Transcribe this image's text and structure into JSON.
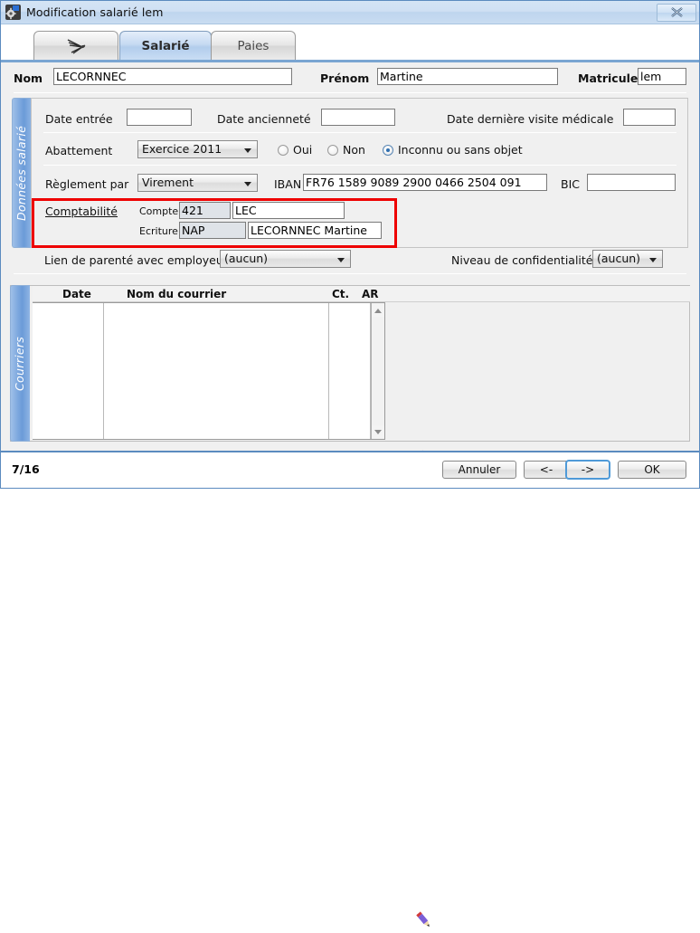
{
  "window": {
    "title": "Modification salarié lem",
    "icon": "app-gear-icon",
    "close_label": "✕"
  },
  "tabs": [
    {
      "label": "",
      "icon": "dragonfly-icon",
      "active": false
    },
    {
      "label": "Salarié",
      "icon": "",
      "active": true
    },
    {
      "label": "Paies",
      "icon": "",
      "active": false
    }
  ],
  "identity": {
    "nom_label": "Nom",
    "nom_value": "LECORNNEC",
    "prenom_label": "Prénom",
    "prenom_value": "Martine",
    "matricule_label": "Matricule",
    "matricule_value": "lem"
  },
  "sections": {
    "donnees_salarie_label": "Données salarié",
    "courriers_label": "Courriers"
  },
  "dates": {
    "date_entree_label": "Date entrée",
    "date_entree_value": "",
    "date_anciennete_label": "Date ancienneté",
    "date_anciennete_value": "",
    "date_visite_label": "Date dernière visite médicale",
    "date_visite_value": ""
  },
  "abattement": {
    "label": "Abattement",
    "combo_value": "Exercice 2011",
    "options": [
      {
        "label": "Oui",
        "checked": false
      },
      {
        "label": "Non",
        "checked": false
      },
      {
        "label": "Inconnu ou sans objet",
        "checked": true
      }
    ]
  },
  "reglement": {
    "label": "Règlement par",
    "combo_value": "Virement",
    "iban_label": "IBAN",
    "iban_value": "FR76 1589 9089 2900 0466 2504 091",
    "bic_label": "BIC",
    "bic_value": ""
  },
  "comptabilite": {
    "title": "Comptabilité",
    "compte_label": "Compte",
    "compte_code": "421",
    "compte_name": "LEC",
    "ecriture_label": "Ecriture",
    "ecriture_code": "NAP",
    "ecriture_name": "LECORNNEC Martine",
    "highlight_color": "#ee0000"
  },
  "footer_fields": {
    "lien_label": "Lien de parenté avec employeur",
    "lien_value": "(aucun)",
    "confidentialite_label": "Niveau de confidentialité",
    "confidentialite_value": "(aucun)"
  },
  "courriers": {
    "columns": [
      "Date",
      "Nom du courrier",
      "Ct.",
      "AR"
    ],
    "rows": [],
    "add_icon": "add-text-letter-icon"
  },
  "statusbar": {
    "page": "7/16",
    "pencil_icon": "pencil-icon",
    "buttons": [
      {
        "name": "cancel",
        "label": "Annuler",
        "focused": false
      },
      {
        "name": "previous",
        "label": "<-",
        "focused": false
      },
      {
        "name": "next",
        "label": "->",
        "focused": true
      },
      {
        "name": "ok",
        "label": "OK",
        "focused": false
      }
    ]
  },
  "colors": {
    "accent": "#5b8bbf",
    "tab_active": "#b2cdec",
    "vtab": "#7fa9df",
    "annotation": "#ee0000"
  }
}
